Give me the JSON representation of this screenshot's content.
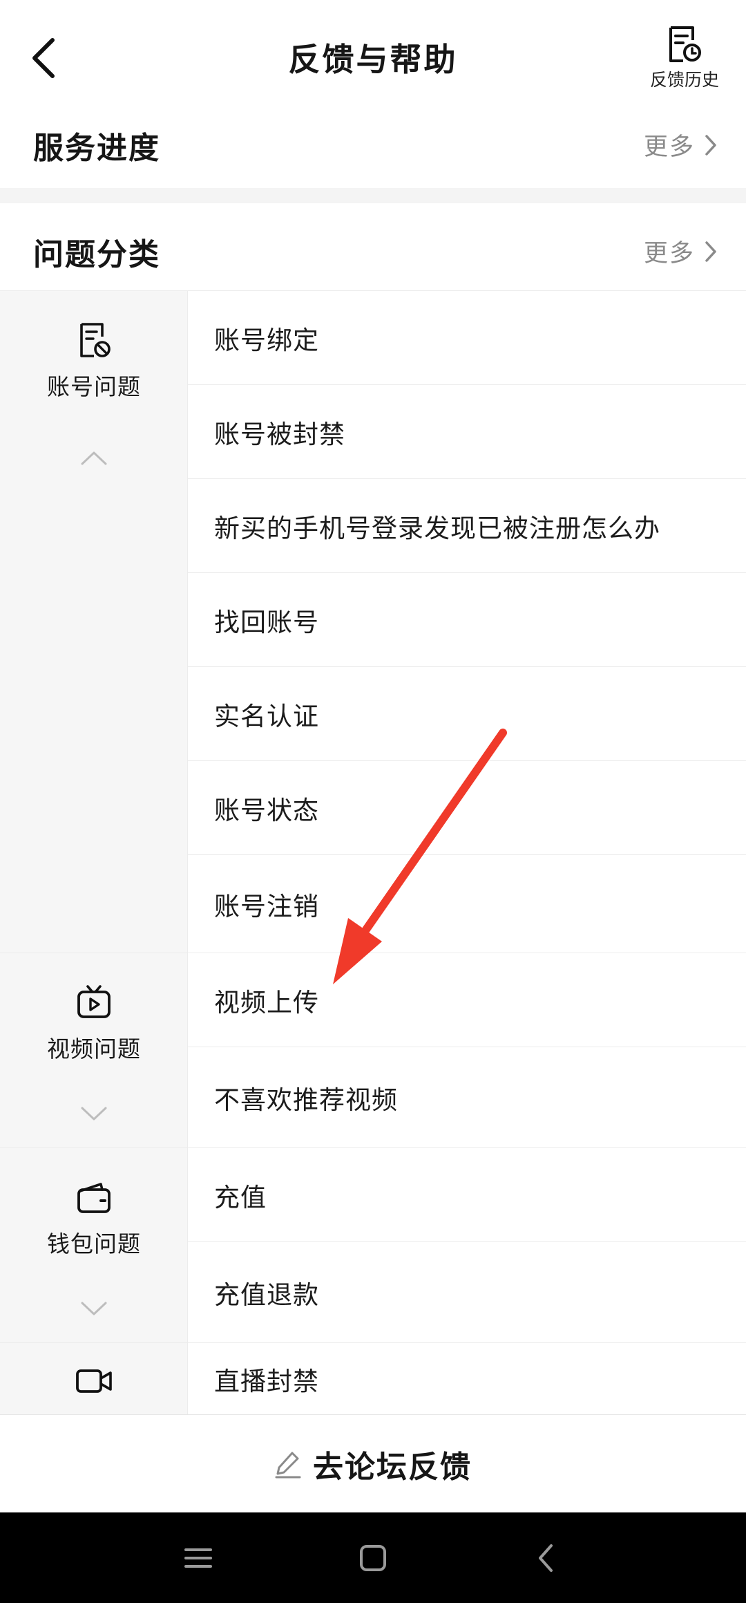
{
  "header": {
    "title": "反馈与帮助",
    "history_label": "反馈历史"
  },
  "service_progress": {
    "title": "服务进度",
    "more_label": "更多"
  },
  "problem_category": {
    "title": "问题分类",
    "more_label": "更多"
  },
  "categories": [
    {
      "label": "账号问题",
      "icon": "account-doc-icon",
      "expanded": true,
      "items": [
        "账号绑定",
        "账号被封禁",
        "新买的手机号登录发现已被注册怎么办",
        "找回账号",
        "实名认证",
        "账号状态",
        "账号注销"
      ]
    },
    {
      "label": "视频问题",
      "icon": "tv-icon",
      "expanded": false,
      "items": [
        "视频上传",
        "不喜欢推荐视频"
      ]
    },
    {
      "label": "钱包问题",
      "icon": "wallet-icon",
      "expanded": false,
      "items": [
        "充值",
        "充值退款"
      ]
    },
    {
      "label": "",
      "icon": "video-camera-icon",
      "expanded": false,
      "items": [
        "直播封禁"
      ]
    }
  ],
  "forum": {
    "label": "去论坛反馈",
    "icon": "edit-pencil-icon"
  },
  "system_nav": {
    "buttons": [
      "menu-icon",
      "home-icon",
      "back-icon"
    ]
  },
  "colors": {
    "annotation_arrow": "#f03a2a",
    "side_background": "#f6f6f6",
    "muted_text": "#8a8a8a"
  }
}
